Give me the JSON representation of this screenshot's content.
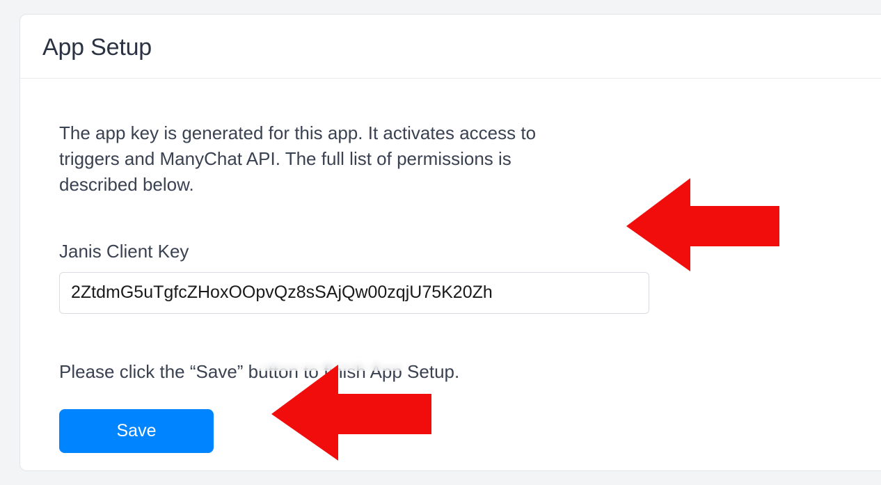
{
  "header": {
    "title": "App Setup"
  },
  "body": {
    "description": "The app key is generated for this app. It activates access to triggers and ManyChat API. The full list of permissions is described below.",
    "field_label": "Janis Client Key",
    "key_value": "2ZtdmG5uTgfcZHoxOOpvQz8sSAjQw00zqjU75K20Zh",
    "instruction": "Please click the “Save” button to finish App Setup.",
    "save_label": "Save"
  },
  "annotations": {
    "arrow_color": "#f20d0d"
  }
}
